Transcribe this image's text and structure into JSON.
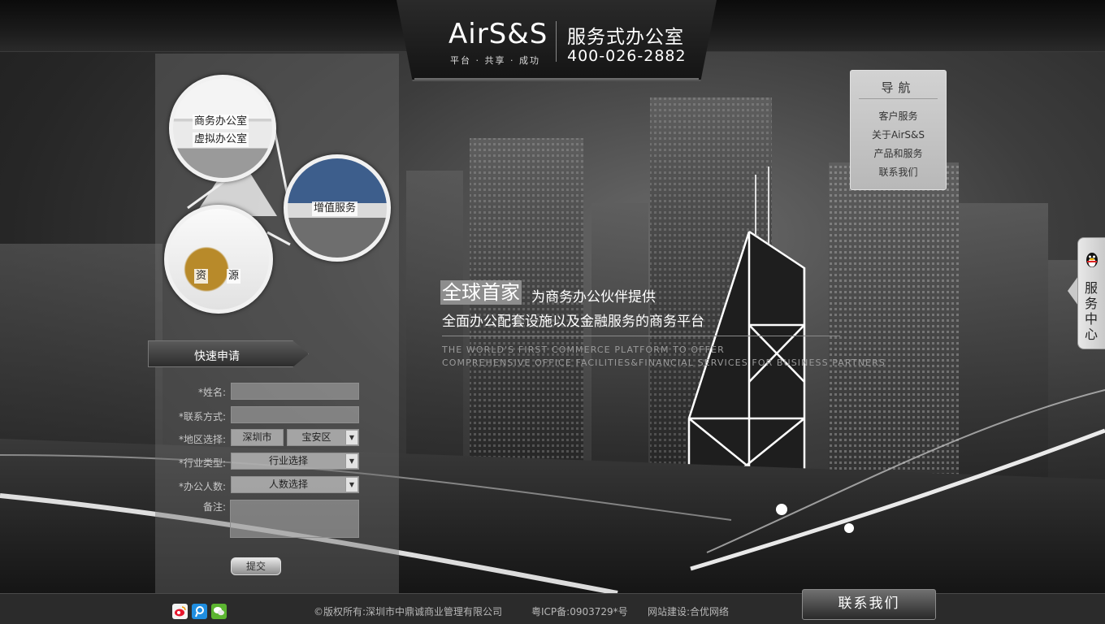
{
  "header": {
    "brand": "AirS&S",
    "slogan": "平台 · 共享 · 成功",
    "service_name": "服务式办公室",
    "phone": "400-026-2882"
  },
  "bubbles": {
    "office_label_1": "商务办公室",
    "office_label_2": "虚拟办公室",
    "value_label": "增值服务",
    "resource_label_1": "资",
    "resource_label_2": "源"
  },
  "form": {
    "title": "快速申请",
    "name_label": "*姓名:",
    "contact_label": "*联系方式:",
    "region_label": "*地区选择:",
    "city_value": "深圳市",
    "district_value": "宝安区",
    "industry_label": "*行业类型:",
    "industry_value": "行业选择",
    "people_label": "*办公人数:",
    "people_value": "人数选择",
    "notes_label": "备注:",
    "submit_label": "提交"
  },
  "headline": {
    "highlight": "全球首家",
    "rest": "为商务办公伙伴提供",
    "line2": "全面办公配套设施以及金融服务的商务平台",
    "english_1": "THE WORLD'S FIRST COMMERCE PLATFORM TO OFFER",
    "english_2": "COMPREHENSIVE OFFICE FACILITIES&FINANCIAL SERVICES FOR BUSINESS PARTNERS"
  },
  "nav": {
    "title": "导航",
    "items": [
      {
        "label": "客户服务"
      },
      {
        "label": "关于AirS&S"
      },
      {
        "label": "产品和服务"
      },
      {
        "label": "联系我们"
      }
    ]
  },
  "service_tab": {
    "label": "服务中心",
    "icon": "qq-penguin-icon"
  },
  "footer": {
    "copyright": "©版权所有:深圳市中鼎诚商业管理有限公司",
    "icp": "粤ICP备:0903729*号",
    "builder": "网站建设:合优网络",
    "contact_button": "联系我们",
    "social_icons": [
      "weibo-icon",
      "tencent-weibo-icon",
      "wechat-icon"
    ]
  }
}
